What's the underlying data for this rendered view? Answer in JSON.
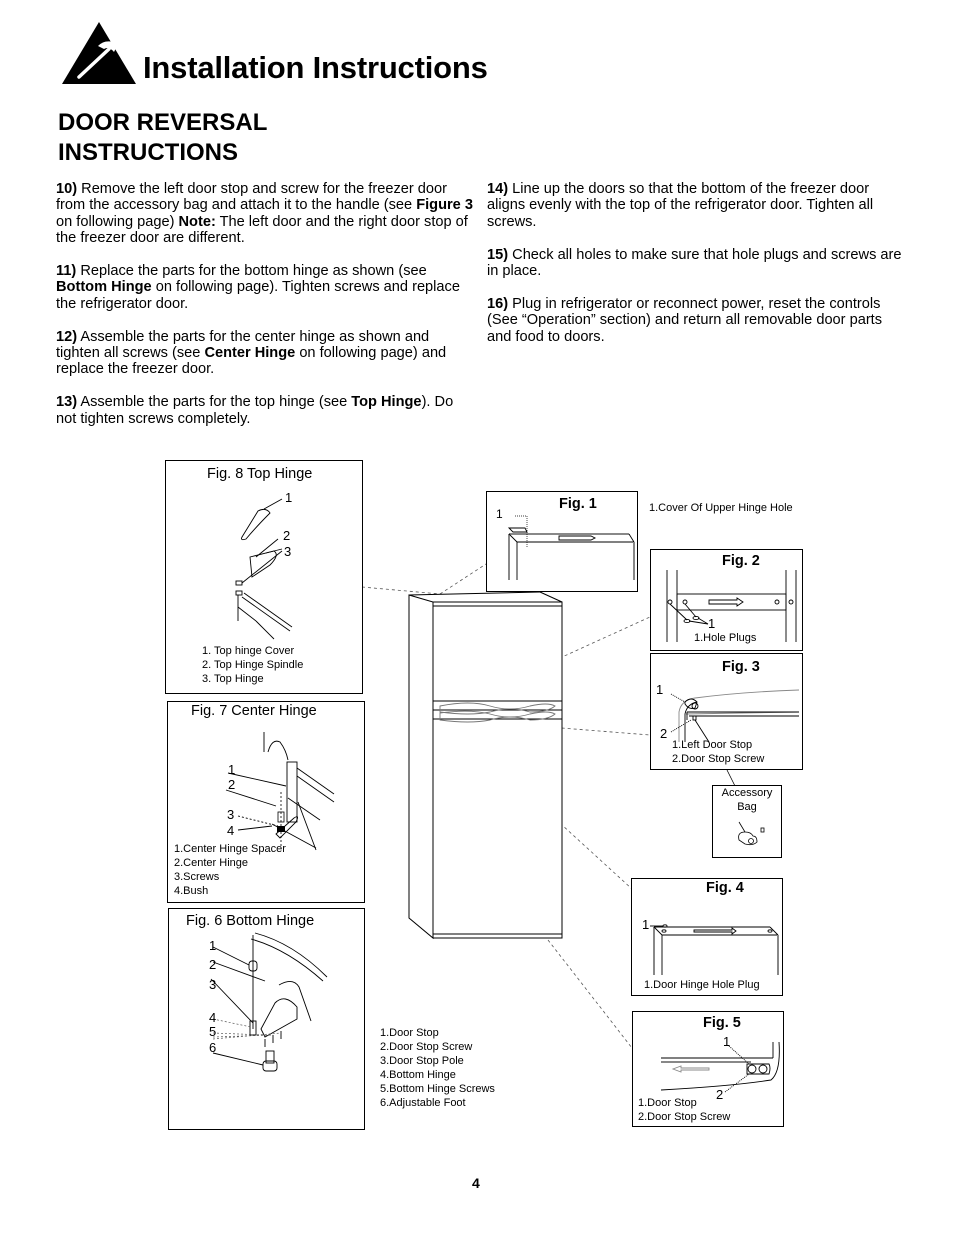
{
  "header": {
    "icon": "hammer-warning-triangle-icon",
    "title": "Installation Instructions"
  },
  "section": {
    "title_line1": "DOOR REVERSAL",
    "title_line2": "INSTRUCTIONS"
  },
  "steps_left": [
    {
      "num": "10)",
      "parts": [
        {
          "t": " Remove the left door stop and screw for the freezer door from the accessory bag and attach it to the handle (see ",
          "b": false
        },
        {
          "t": "Figure 3",
          "b": true
        },
        {
          "t": " on following page) ",
          "b": false
        },
        {
          "t": "Note:",
          "b": true
        },
        {
          "t": " The left door and  the right door  stop of the freezer door are different.",
          "b": false
        }
      ]
    },
    {
      "num": "11)",
      "parts": [
        {
          "t": " Replace the parts for the bottom hinge as shown (see ",
          "b": false
        },
        {
          "t": "Bottom Hinge",
          "b": true
        },
        {
          "t": " on following page). Tighten screws and replace the refrigerator door.",
          "b": false
        }
      ]
    },
    {
      "num": "12)",
      "parts": [
        {
          "t": " Assemble the parts for the center hinge as shown and tighten all screws (see ",
          "b": false
        },
        {
          "t": "Center Hinge",
          "b": true
        },
        {
          "t": " on following page) and replace the freezer door.",
          "b": false
        }
      ]
    },
    {
      "num": "13)",
      "parts": [
        {
          "t": " Assemble the parts for the top hinge (see ",
          "b": false
        },
        {
          "t": "Top Hinge",
          "b": true
        },
        {
          "t": "). Do not tighten screws completely.",
          "b": false
        }
      ]
    }
  ],
  "steps_right": [
    {
      "num": "14)",
      "parts": [
        {
          "t": " Line up the doors so that the bottom of the freezer door aligns evenly with the top of the refrigerator door. Tighten all screws.",
          "b": false
        }
      ]
    },
    {
      "num": "15)",
      "parts": [
        {
          "t": " Check all holes to make sure that hole plugs and screws are in place.",
          "b": false
        }
      ]
    },
    {
      "num": "16)",
      "parts": [
        {
          "t": " Plug in refrigerator or reconnect power, reset the controls (See “Operation” section) and return all removable door parts and food to doors.",
          "b": false
        }
      ]
    }
  ],
  "figures": {
    "fig8": {
      "title": "Fig. 8 Top Hinge",
      "callouts": [
        "1",
        "2",
        "3"
      ],
      "legend": [
        "1. Top hinge Cover",
        "2. Top Hinge Spindle",
        "3. Top Hinge"
      ]
    },
    "fig7": {
      "title": "Fig. 7 Center Hinge",
      "callouts": [
        "1",
        "2",
        "3",
        "4"
      ],
      "legend": [
        "1.Center Hinge Spacer",
        "2.Center Hinge",
        "3.Screws",
        "4.Bush"
      ]
    },
    "fig6": {
      "title": "Fig. 6 Bottom Hinge",
      "callouts": [
        "1",
        "2",
        "3",
        "4",
        "5",
        "6"
      ],
      "legend": [
        "1.Door Stop",
        "2.Door Stop Screw",
        "3.Door Stop Pole",
        "4.Bottom Hinge",
        "5.Bottom Hinge Screws",
        "6.Adjustable Foot"
      ]
    },
    "fig1": {
      "title": "Fig. 1",
      "callouts": [
        "1"
      ],
      "legend": [
        "1.Cover Of Upper Hinge Hole"
      ]
    },
    "fig2": {
      "title": "Fig. 2",
      "callouts": [
        "1"
      ],
      "legend": [
        "1.Hole Plugs"
      ]
    },
    "fig3": {
      "title": "Fig. 3",
      "callouts": [
        "1",
        "2"
      ],
      "legend": [
        "1.Left Door Stop",
        "2.Door Stop Screw"
      ]
    },
    "accessory_bag": {
      "label_line1": "Accessory",
      "label_line2": "Bag"
    },
    "fig4": {
      "title": "Fig. 4",
      "callouts": [
        "1"
      ],
      "legend": [
        "1.Door Hinge Hole Plug"
      ]
    },
    "fig5": {
      "title": "Fig. 5",
      "callouts": [
        "1",
        "2"
      ],
      "legend": [
        "1.Door Stop",
        "2.Door Stop Screw"
      ]
    }
  },
  "page_number": "4"
}
